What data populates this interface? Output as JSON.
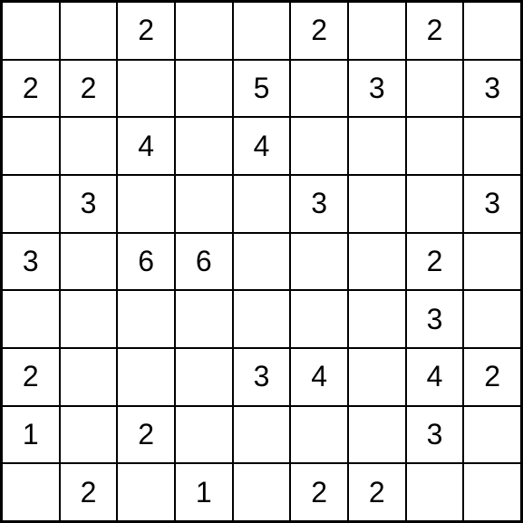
{
  "grid": {
    "rows": 9,
    "cols": 9,
    "cells": [
      [
        "",
        "",
        "2",
        "",
        "",
        "2",
        "",
        "2",
        ""
      ],
      [
        "2",
        "2",
        "",
        "",
        "5",
        "",
        "3",
        "",
        "3"
      ],
      [
        "",
        "",
        "4",
        "",
        "4",
        "",
        "",
        "",
        ""
      ],
      [
        "",
        "3",
        "",
        "",
        "",
        "3",
        "",
        "",
        "3"
      ],
      [
        "3",
        "",
        "6",
        "6",
        "",
        "",
        "",
        "2",
        ""
      ],
      [
        "",
        "",
        "",
        "",
        "",
        "",
        "",
        "3",
        ""
      ],
      [
        "2",
        "",
        "",
        "",
        "3",
        "4",
        "",
        "4",
        "2"
      ],
      [
        "1",
        "",
        "2",
        "",
        "",
        "",
        "",
        "3",
        ""
      ],
      [
        "",
        "2",
        "",
        "1",
        "",
        "2",
        "2",
        "",
        ""
      ]
    ]
  }
}
